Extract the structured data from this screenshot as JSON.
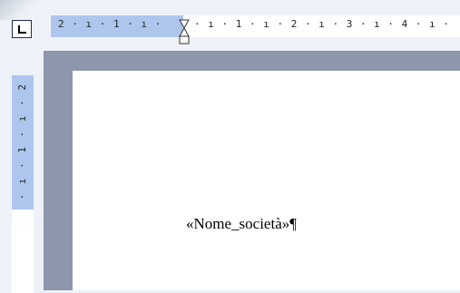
{
  "ruler": {
    "horizontal_margin_ticks": "2 · ı · 1 · ı ·",
    "horizontal_text_ticks": "· ı · 1 · ı · 2 · ı · 3 · ı · 4 · ı ·",
    "vertical_ticks": "· ı · 1 · ı · 2"
  },
  "document": {
    "field": "«Nome_società»",
    "pilcrow": "¶"
  },
  "icons": {
    "tab_selector": "left-tab-icon",
    "indent": "hourglass-indent-icon"
  },
  "colors": {
    "ruler_margin": "#aec6ee",
    "workspace": "#8d97ab",
    "page": "#ffffff"
  }
}
